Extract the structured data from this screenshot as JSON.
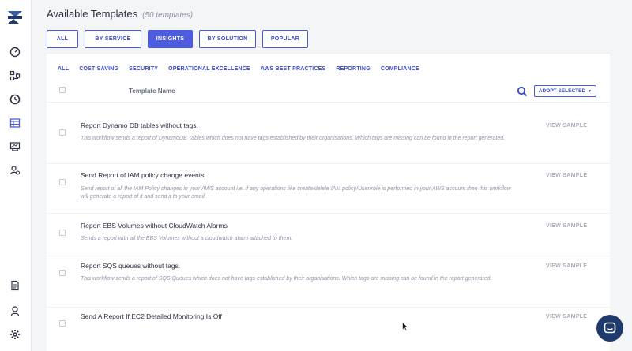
{
  "header": {
    "title": "Available Templates",
    "count": "(50 templates)"
  },
  "tabs": [
    {
      "label": "ALL",
      "active": false
    },
    {
      "label": "BY SERVICE",
      "active": false
    },
    {
      "label": "INSIGHTS",
      "active": true
    },
    {
      "label": "BY SOLUTION",
      "active": false
    },
    {
      "label": "POPULAR",
      "active": false
    }
  ],
  "filters": [
    "ALL",
    "COST SAVING",
    "SECURITY",
    "OPERATIONAL EXCELLENCE",
    "AWS BEST PRACTICES",
    "REPORTING",
    "COMPLIANCE"
  ],
  "table": {
    "column_name": "Template Name",
    "adopt_label": "ADOPT SELECTED",
    "view_label": "VIEW SAMPLE"
  },
  "rows": [
    {
      "title": "Report Dynamo DB tables without tags.",
      "desc": "This workflow sends a report of DynamoDB Tables which does not have tags established by their organisations. Which tags are missing can be found in the report generated."
    },
    {
      "title": "Send Report of IAM policy change events.",
      "desc": "Send report of all the IAM Policy changes in your AWS account i.e. if any operations like create/delete IAM policy/User/role is performed in your AWS account then this workflow will generate a report of it and send it to your email."
    },
    {
      "title": "Report EBS Volumes without CloudWatch Alarms",
      "desc": "Sends a report with all the EBS Volumes without a cloudwatch alarm attached to them."
    },
    {
      "title": "Report SQS queues without tags.",
      "desc": "This workflow sends a report of SQS Queues which does not have tags established by their organisations. Which tags are missing can be found in the report generated."
    },
    {
      "title": "Send A Report If EC2 Detailed Monitoring Is Off",
      "desc": ""
    }
  ],
  "colors": {
    "accent": "#4e5de0",
    "chat": "#1f3b6e"
  }
}
